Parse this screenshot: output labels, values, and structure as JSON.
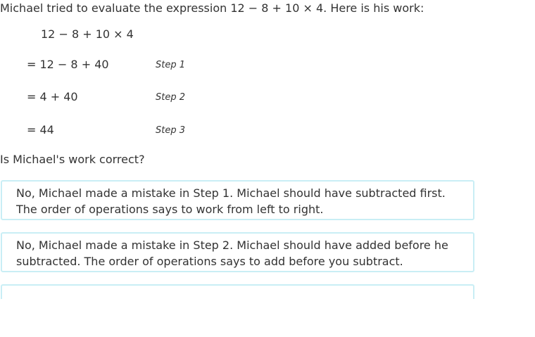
{
  "question": {
    "text": "Michael tried to evaluate the expression 12 − 8 + 10 × 4. Here is his work:"
  },
  "work": {
    "expression": "12 − 8 + 10 × 4",
    "steps": [
      {
        "equation": "= 12 − 8 + 40",
        "label": "Step 1"
      },
      {
        "equation": "= 4 + 40",
        "label": "Step 2"
      },
      {
        "equation": "= 44",
        "label": "Step 3"
      }
    ]
  },
  "prompt": "Is Michael's work correct?",
  "choices": [
    {
      "line1": "No, Michael made a mistake in Step 1. Michael should have subtracted first.",
      "line2": "The order of operations says to work from left to right."
    },
    {
      "line1": "No, Michael made a mistake in Step 2. Michael should have added before he",
      "line2": "subtracted. The order of operations says to add before you subtract."
    }
  ],
  "colors": {
    "text": "#333333",
    "choice_border": "#c9eef5",
    "background": "#ffffff"
  }
}
